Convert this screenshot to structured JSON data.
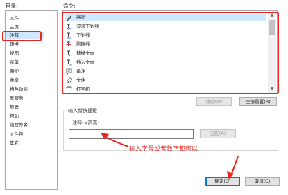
{
  "labels": {
    "directory": "目录:",
    "commands": "命令:"
  },
  "categories": [
    {
      "label": "文件"
    },
    {
      "label": "主页"
    },
    {
      "label": "注释"
    },
    {
      "label": "转换"
    },
    {
      "label": "视图"
    },
    {
      "label": "表单"
    },
    {
      "label": "保护"
    },
    {
      "label": "共享"
    },
    {
      "label": "特色功能"
    },
    {
      "label": "云服务"
    },
    {
      "label": "旅睐"
    },
    {
      "label": "帮助"
    },
    {
      "label": "填写签名"
    },
    {
      "label": "文件包"
    },
    {
      "label": "其它"
    }
  ],
  "selected_category": "注释",
  "commands": [
    {
      "label": "高亮",
      "icon": "highlight-pen-icon"
    },
    {
      "label": "波浪下划线",
      "icon": "wavy-underline-icon"
    },
    {
      "label": "下划线",
      "icon": "underline-icon"
    },
    {
      "label": "删除线",
      "icon": "strikethrough-icon"
    },
    {
      "label": "替换文本",
      "icon": "replace-text-icon"
    },
    {
      "label": "插入文本",
      "icon": "insert-text-icon"
    },
    {
      "label": "备注",
      "icon": "note-icon"
    },
    {
      "label": "文件",
      "icon": "attach-file-icon"
    },
    {
      "label": "打字机",
      "icon": "typewriter-icon"
    }
  ],
  "selected_command": "高亮",
  "buttons": {
    "remove": "移除(M)",
    "reset_all": "全部重置(R)",
    "assign": "分配(A)",
    "ok": "确定(O)",
    "cancel": "取消(C)"
  },
  "shortcut": {
    "group_title": "输入新快捷键",
    "field_label": "注释->高亮:",
    "value": ""
  },
  "annotation": {
    "text": "输入字母或者数字都可以",
    "color": "#e8251e"
  },
  "colors": {
    "selection": "#cde8ff",
    "primary_border": "#0078d7"
  }
}
